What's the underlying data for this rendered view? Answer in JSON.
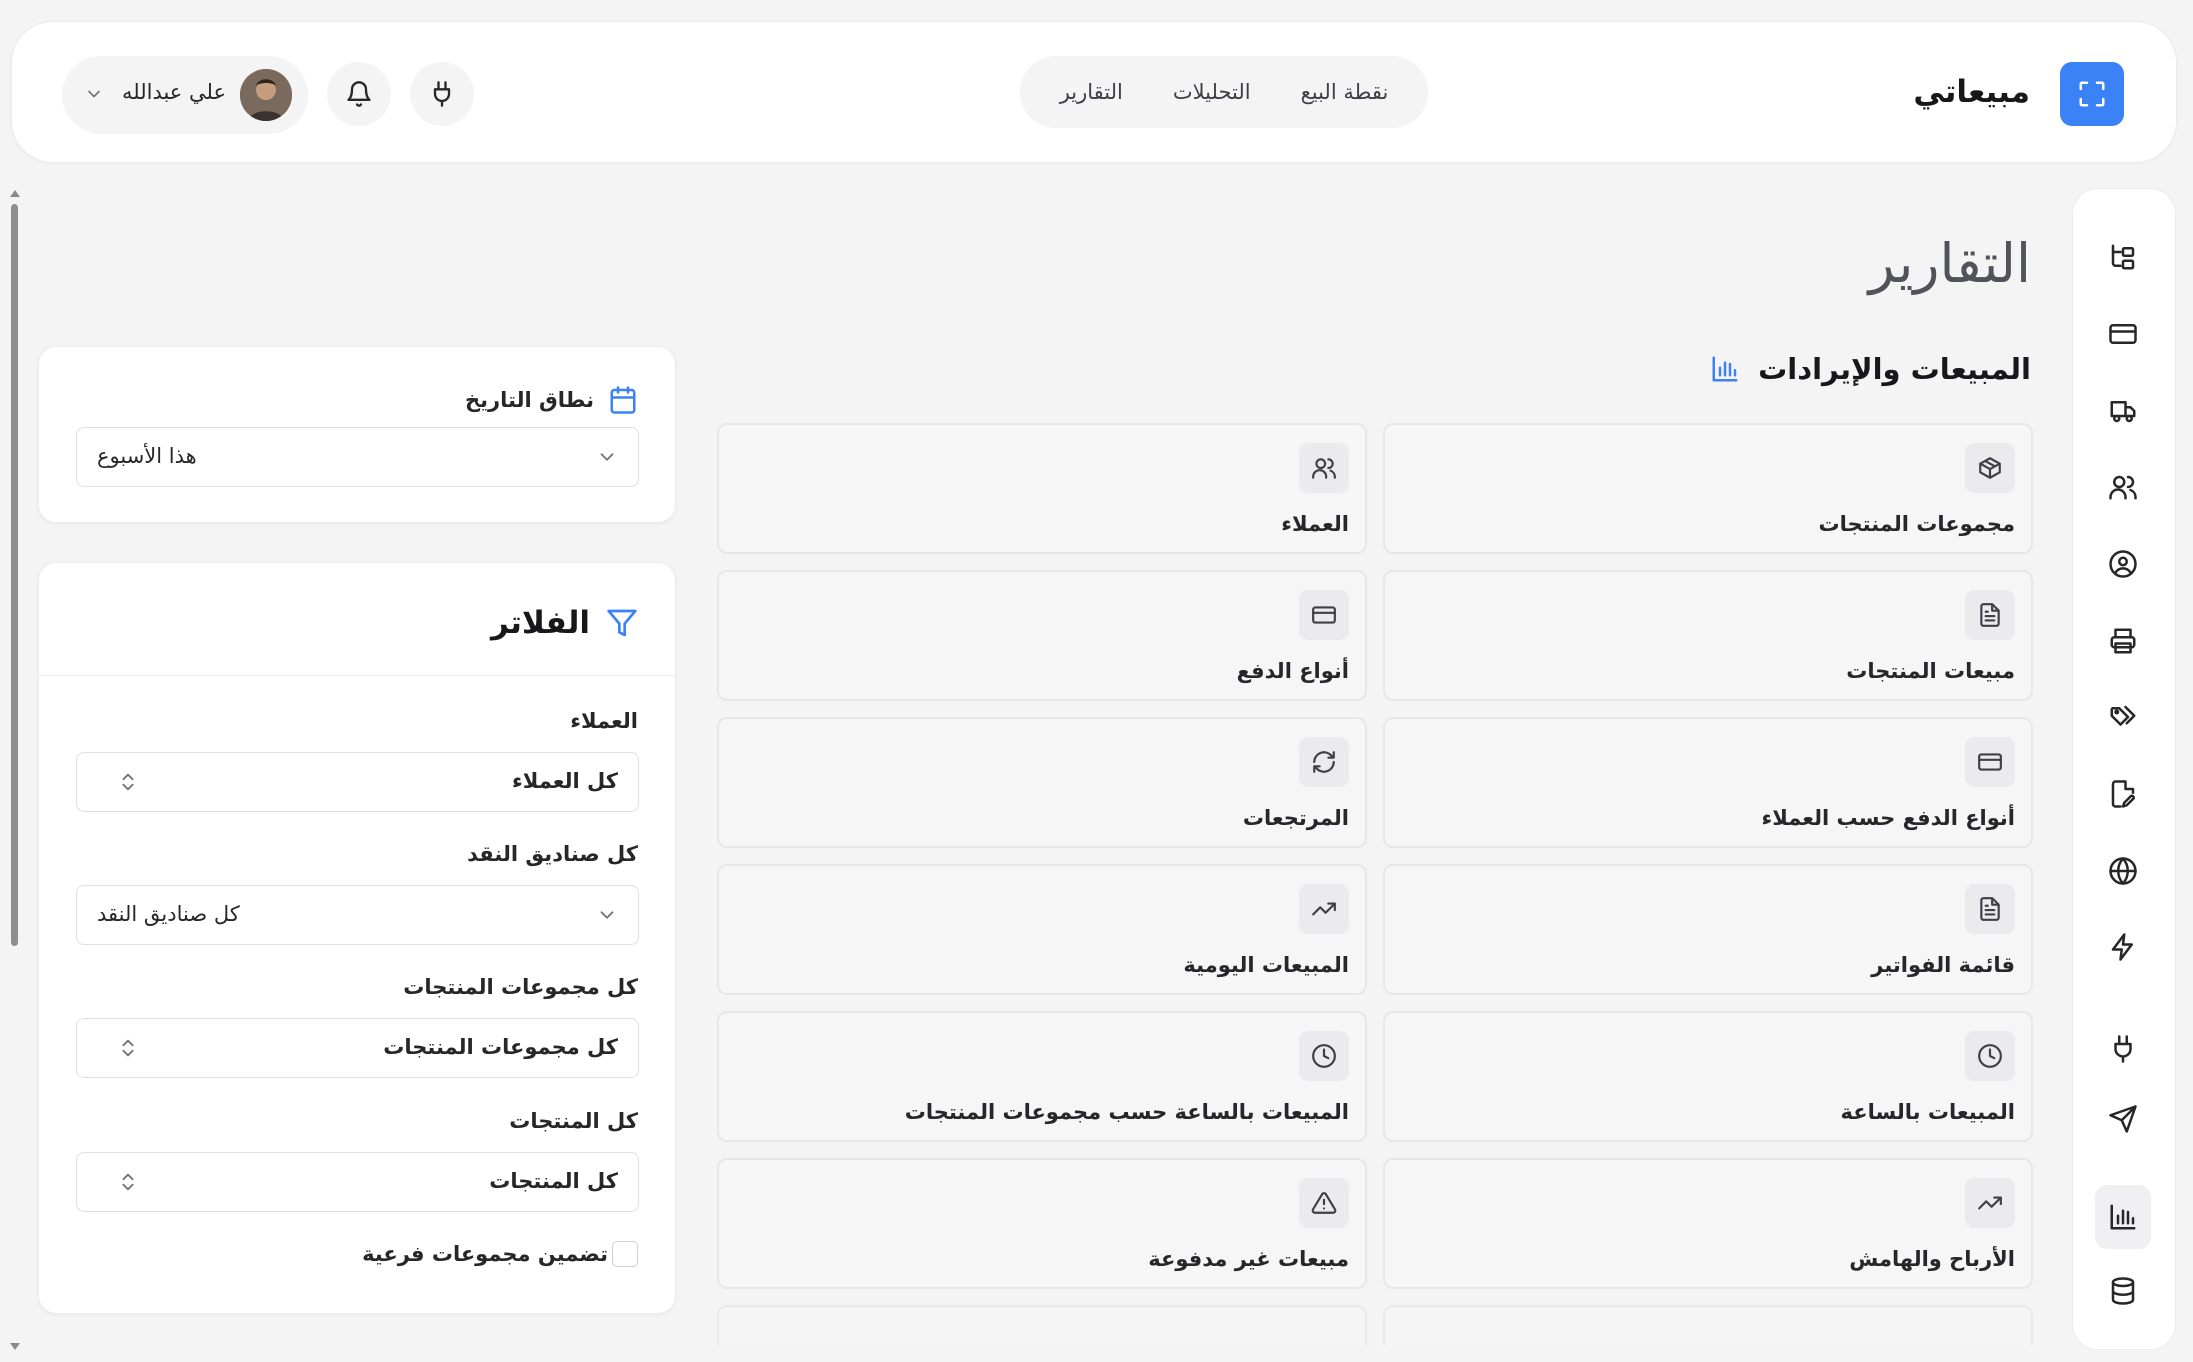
{
  "header": {
    "brand_name": "مبيعاتي",
    "nav": [
      {
        "label": "نقطة البيع"
      },
      {
        "label": "التحليلات"
      },
      {
        "label": "التقارير"
      }
    ],
    "user_name": "علي عبدالله"
  },
  "page": {
    "title": "التقارير"
  },
  "section": {
    "title": "المبيعات والإيرادات",
    "icon": "bar-chart-icon"
  },
  "reports": [
    {
      "label": "مجموعات المنتجات",
      "icon": "package-icon"
    },
    {
      "label": "العملاء",
      "icon": "users-icon"
    },
    {
      "label": "مبيعات المنتجات",
      "icon": "file-text-icon"
    },
    {
      "label": "أنواع الدفع",
      "icon": "credit-card-icon"
    },
    {
      "label": "أنواع الدفع حسب العملاء",
      "icon": "credit-card-icon"
    },
    {
      "label": "المرتجعات",
      "icon": "refresh-icon"
    },
    {
      "label": "قائمة الفواتير",
      "icon": "file-text-icon"
    },
    {
      "label": "المبيعات اليومية",
      "icon": "trending-up-icon"
    },
    {
      "label": "المبيعات بالساعة",
      "icon": "clock-icon"
    },
    {
      "label": "المبيعات بالساعة حسب مجموعات المنتجات",
      "icon": "clock-icon"
    },
    {
      "label": "الأرباح والهامش",
      "icon": "trending-up-icon"
    },
    {
      "label": "مبيعات غير مدفوعة",
      "icon": "alert-triangle-icon"
    }
  ],
  "date_range": {
    "label": "نطاق التاريخ",
    "value": "هذا الأسبوع"
  },
  "filters": {
    "title": "الفلاتر",
    "customers_label": "العملاء",
    "customers_value": "كل العملاء",
    "cash_registers_label": "كل صناديق النقد",
    "cash_registers_value": "كل صناديق النقد",
    "product_groups_label": "كل مجموعات المنتجات",
    "product_groups_value": "كل مجموعات المنتجات",
    "products_label": "كل المنتجات",
    "products_value": "كل المنتجات",
    "include_subgroups_label": "تضمين مجموعات فرعية",
    "include_subgroups_checked": false
  },
  "sidebar_icons": [
    "hierarchy-icon",
    "credit-card-icon",
    "truck-icon",
    "users-icon",
    "user-circle-icon",
    "printer-icon",
    "tags-icon",
    "file-edit-icon",
    "globe-icon",
    "zap-icon",
    "plug-icon",
    "send-icon",
    "bar-chart-icon",
    "database-icon"
  ],
  "colors": {
    "accent": "#3b82f6",
    "background": "#f4f4f5",
    "card": "#f6f6f7"
  }
}
